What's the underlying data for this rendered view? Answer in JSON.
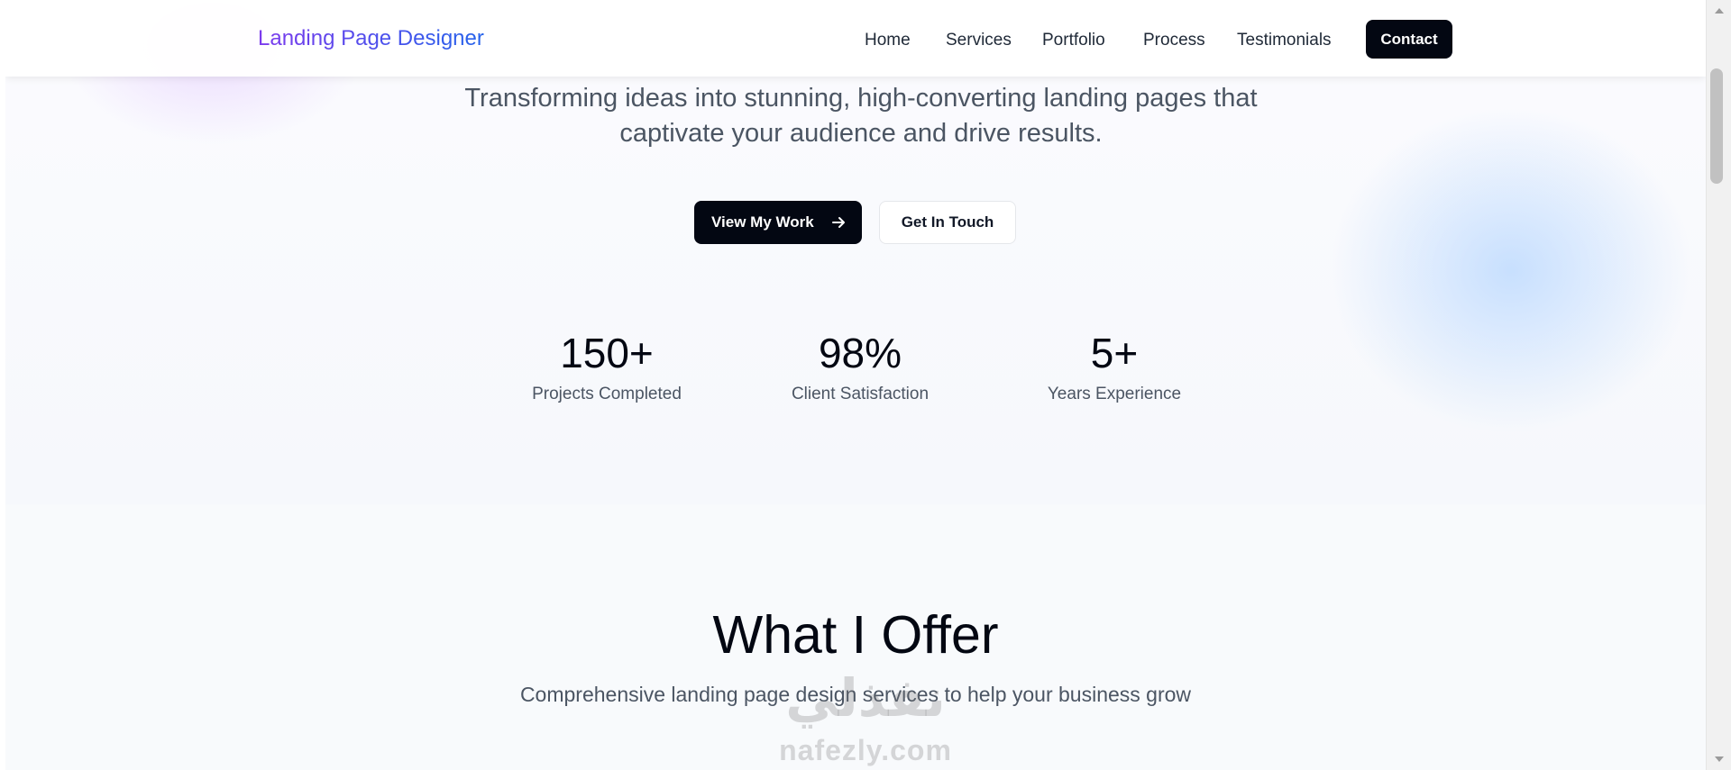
{
  "navbar": {
    "brand": "Landing Page Designer",
    "links": [
      "Home",
      "Services",
      "Portfolio",
      "Process",
      "Testimonials"
    ],
    "contact_label": "Contact"
  },
  "hero": {
    "tagline_line1": "Transforming ideas into stunning, high-converting landing pages that",
    "tagline_line2": "captivate your audience and drive results.",
    "primary_button": "View My Work",
    "secondary_button": "Get In Touch",
    "stats": [
      {
        "value": "150+",
        "label": "Projects Completed"
      },
      {
        "value": "98%",
        "label": "Client Satisfaction"
      },
      {
        "value": "5+",
        "label": "Years Experience"
      }
    ]
  },
  "offer": {
    "title": "What I Offer",
    "subtitle": "Comprehensive landing page design services to help your business grow"
  },
  "watermark": {
    "arabic": "نفذلي",
    "latin": "nafezly.com"
  },
  "icons": {
    "button_arrow": "arrow-right-icon",
    "scroll_up": "scroll-up-arrow-icon",
    "scroll_down": "scroll-down-arrow-icon"
  },
  "colors": {
    "brand_gradient_start": "#7c3aed",
    "brand_gradient_end": "#2563eb",
    "button_dark": "#030712",
    "text_muted": "#4b5563"
  }
}
